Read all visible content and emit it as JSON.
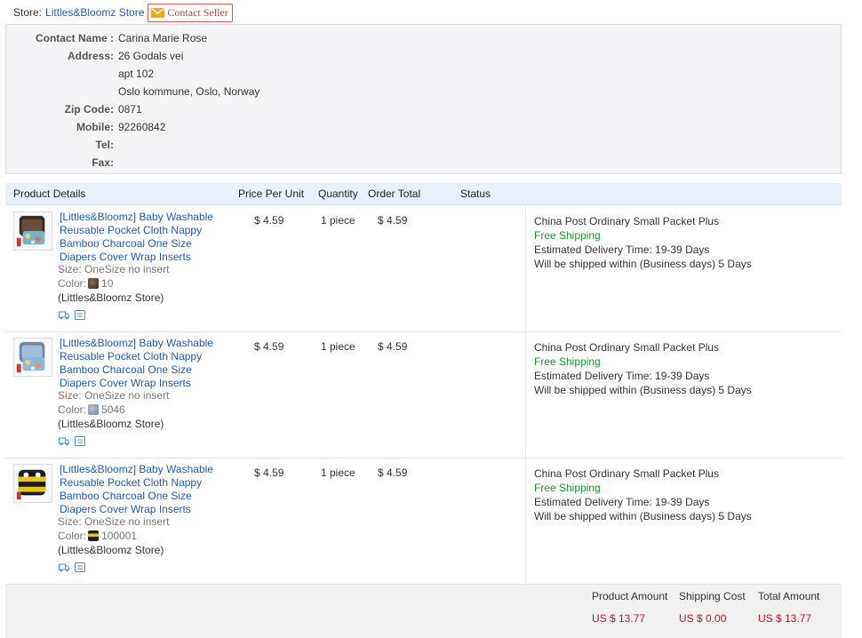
{
  "store": {
    "label": "Store:",
    "name": "Littles&Bloomz Store",
    "contact_seller": "Contact Seller"
  },
  "address": {
    "contact_name_label": "Contact Name :",
    "contact_name": "Carina Marie Rose",
    "address_label": "Address:",
    "address_line1": "26 Godals vei",
    "address_line2": "apt 102",
    "address_line3": "Oslo kommune, Oslo, Norway",
    "zip_label": "Zip Code:",
    "zip": "0871",
    "mobile_label": "Mobile:",
    "mobile": "92260842",
    "tel_label": "Tel:",
    "tel": "",
    "fax_label": "Fax:",
    "fax": ""
  },
  "columns": {
    "product_details": "Product Details",
    "price_per_unit": "Price Per Unit",
    "quantity": "Quantity",
    "order_total": "Order Total",
    "status": "Status"
  },
  "items": [
    {
      "title": "[Littles&Bloomz] Baby Washable Reusable Pocket Cloth Nappy Bamboo Charcoal One Size Diapers Cover Wrap Inserts",
      "size": "Size: OneSize no insert",
      "color_label": "Color:",
      "color_value": "10",
      "store": "(Littles&Bloomz Store)",
      "price": "$ 4.59",
      "quantity": "1 piece",
      "total": "$ 4.59",
      "status": "",
      "shipping_method": "China Post Ordinary Small Packet Plus",
      "shipping_fee": "Free Shipping",
      "delivery_time": "Estimated Delivery Time:  19-39 Days",
      "ship_within": "Will be shipped within (Business days)  5 Days"
    },
    {
      "title": "[Littles&Bloomz] Baby Washable Reusable Pocket Cloth Nappy Bamboo Charcoal One Size Diapers Cover Wrap Inserts",
      "size": "Size: OneSize no insert",
      "color_label": "Color:",
      "color_value": "5046",
      "store": "(Littles&Bloomz Store)",
      "price": "$ 4.59",
      "quantity": "1 piece",
      "total": "$ 4.59",
      "status": "",
      "shipping_method": "China Post Ordinary Small Packet Plus",
      "shipping_fee": "Free Shipping",
      "delivery_time": "Estimated Delivery Time:  19-39 Days",
      "ship_within": "Will be shipped within (Business days)  5 Days"
    },
    {
      "title": "[Littles&Bloomz] Baby Washable Reusable Pocket Cloth Nappy Bamboo Charcoal One Size Diapers Cover Wrap Inserts",
      "size": "Size: OneSize no insert",
      "color_label": "Color:",
      "color_value": "100001",
      "store": "(Littles&Bloomz Store)",
      "price": "$ 4.59",
      "quantity": "1 piece",
      "total": "$ 4.59",
      "status": "",
      "shipping_method": "China Post Ordinary Small Packet Plus",
      "shipping_fee": "Free Shipping",
      "delivery_time": "Estimated Delivery Time:  19-39 Days",
      "ship_within": "Will be shipped within (Business days)  5 Days"
    }
  ],
  "summary": {
    "product_amount_label": "Product Amount",
    "product_amount": "US $ 13.77",
    "shipping_cost_label": "Shipping Cost",
    "shipping_cost": "US $ 0.00",
    "total_amount_label": "Total Amount",
    "total_amount": "US $ 13.77"
  },
  "icons": {
    "contact": "mail-icon",
    "row_actions": [
      "truck-icon",
      "list-icon"
    ]
  },
  "colors": {
    "link": "#1f5bb8",
    "free_shipping": "#179b2c",
    "price_red": "#c4162a",
    "header_bg": "#e8f1fb"
  }
}
